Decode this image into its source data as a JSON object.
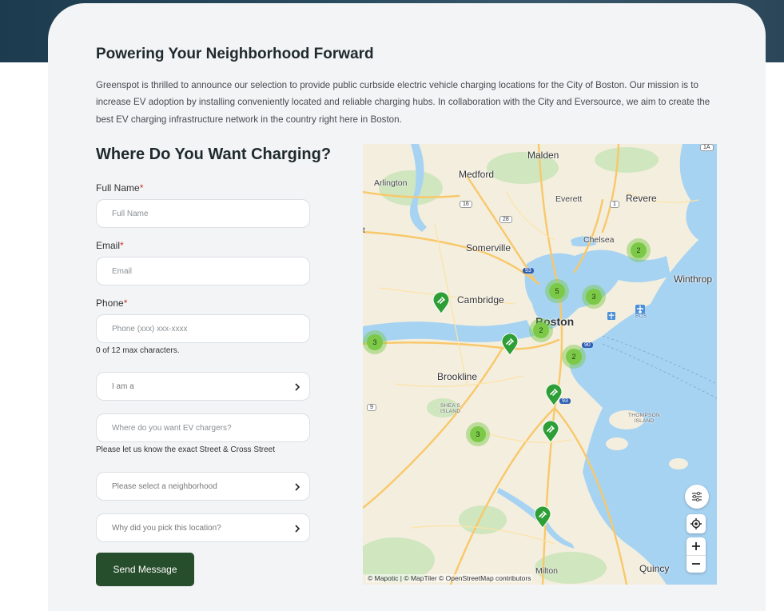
{
  "header": {
    "title": "Powering Your Neighborhood Forward",
    "intro": "Greenspot is thrilled to announce our selection to provide public curbside electric vehicle charging locations for the City of Boston. Our mission is to increase EV adoption by installing conveniently located and reliable charging hubs. In collaboration with the City and Eversource, we aim to create the best EV charging infrastructure network in the country right here in Boston."
  },
  "form": {
    "title": "Where Do You Want Charging?",
    "full_name": {
      "label": "Full Name",
      "required_mark": "*",
      "placeholder": "Full Name"
    },
    "email": {
      "label": "Email",
      "required_mark": "*",
      "placeholder": "Email"
    },
    "phone": {
      "label": "Phone",
      "required_mark": "*",
      "placeholder": "Phone (xxx) xxx-xxxx",
      "counter": "0 of 12 max characters."
    },
    "role_select": {
      "value": "I am a"
    },
    "location_input": {
      "placeholder": "Where do you want EV chargers?",
      "hint": "Please let us know the exact Street & Cross Street"
    },
    "neighborhood_select": {
      "value": "Please select a neighborhood"
    },
    "reason_select": {
      "value": "Why did you pick this location?"
    },
    "submit_label": "Send Message"
  },
  "map": {
    "places": {
      "malden": "Malden",
      "medford": "Medford",
      "arlington": "Arlington",
      "everett": "Everett",
      "revere": "Revere",
      "somerville": "Somerville",
      "chelsea": "Chelsea",
      "winthrop": "Winthrop",
      "cambridge": "Cambridge",
      "boston": "Boston",
      "brookline": "Brookline",
      "sheas_island": "SHEA'S ISLAND",
      "thompson_island": "THOMPSON ISLAND",
      "quincy": "Quincy",
      "milton": "Milton",
      "partial_left": "t"
    },
    "route_shields": [
      "16",
      "28",
      "93",
      "1",
      "90",
      "93",
      "9",
      "1A"
    ],
    "airport_code": "BOS",
    "clusters": [
      {
        "name": "northeast",
        "count": "2"
      },
      {
        "name": "charlestown",
        "count": "5"
      },
      {
        "name": "east-boston",
        "count": "3"
      },
      {
        "name": "downtown",
        "count": "2"
      },
      {
        "name": "south-boston",
        "count": "2"
      },
      {
        "name": "west",
        "count": "3"
      },
      {
        "name": "jamaica-plain",
        "count": "3"
      }
    ],
    "pins": [
      "cambridge",
      "back-bay",
      "dorchester",
      "roxbury",
      "mattapan"
    ],
    "attribution": "© Mapotic | © MapTiler © OpenStreetMap contributors",
    "controls": [
      "filter-icon",
      "locate-icon",
      "zoom-in-icon",
      "zoom-out-icon"
    ],
    "colors": {
      "water": "#a7d3f2",
      "land": "#f4eede",
      "park": "#cfe6bf",
      "road": "#f8c86a",
      "cluster": "#7bc947",
      "pin": "#2e9e36"
    }
  },
  "theme": {
    "button_bg": "#274e2c",
    "card_bg": "#f3f4f6"
  }
}
